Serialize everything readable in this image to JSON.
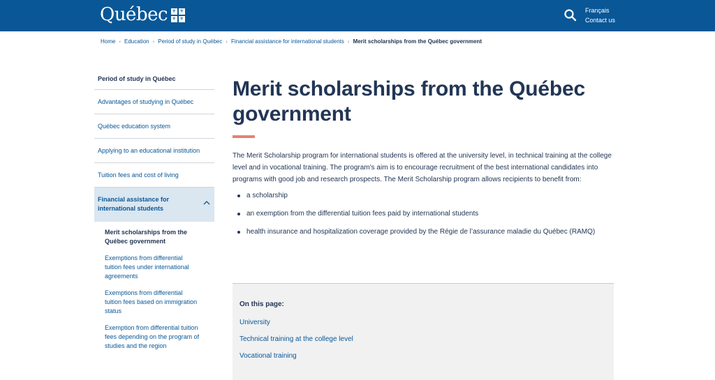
{
  "header": {
    "logo_text": "Québec",
    "francais_label": "Français",
    "contact_label": "Contact us",
    "colors": {
      "brand": "#095797",
      "accent": "#e58271",
      "text": "#223654",
      "active_bg": "#dae6f0"
    }
  },
  "breadcrumb": [
    "Home",
    "Education",
    "Period of study in Québec",
    "Financial assistance for international students",
    "Merit scholarships from the Québec government"
  ],
  "sidebar": {
    "title": "Period of study in Québec",
    "items": [
      "Advantages of studying in Québec",
      "Québec education system",
      "Applying to an educational institution",
      "Tuition fees and cost of living"
    ],
    "active_section": "Financial assistance for international students",
    "sub_items": [
      "Merit scholarships from the Québec government",
      "Exemptions from differential tuition fees under international agreements",
      "Exemptions from differential tuition fees based on immigration status",
      "Exemption from differential tuition fees depending on the program of studies and the region"
    ]
  },
  "main": {
    "title": "Merit scholarships from the Québec government",
    "intro": "The Merit Scholarship program for international students is offered at the university level, in technical training at the college level and in vocational training. The program’s aim is to encourage recruitment of the best international candidates into programs with good job and research prospects. The Merit Scholarship program allows recipients to benefit from:",
    "bullets": [
      "a scholarship",
      "an exemption from the differential tuition fees paid by international students",
      "health insurance and hospitalization coverage provided by the Régie de l’assurance maladie du Québec (RAMQ)"
    ]
  },
  "on_this_page": {
    "label": "On this page:",
    "links": [
      "University",
      "Technical training at the college level",
      "Vocational training"
    ]
  },
  "icons": [
    "fleur-de-lis-flag-icon",
    "search-icon",
    "chevron-up-icon"
  ]
}
